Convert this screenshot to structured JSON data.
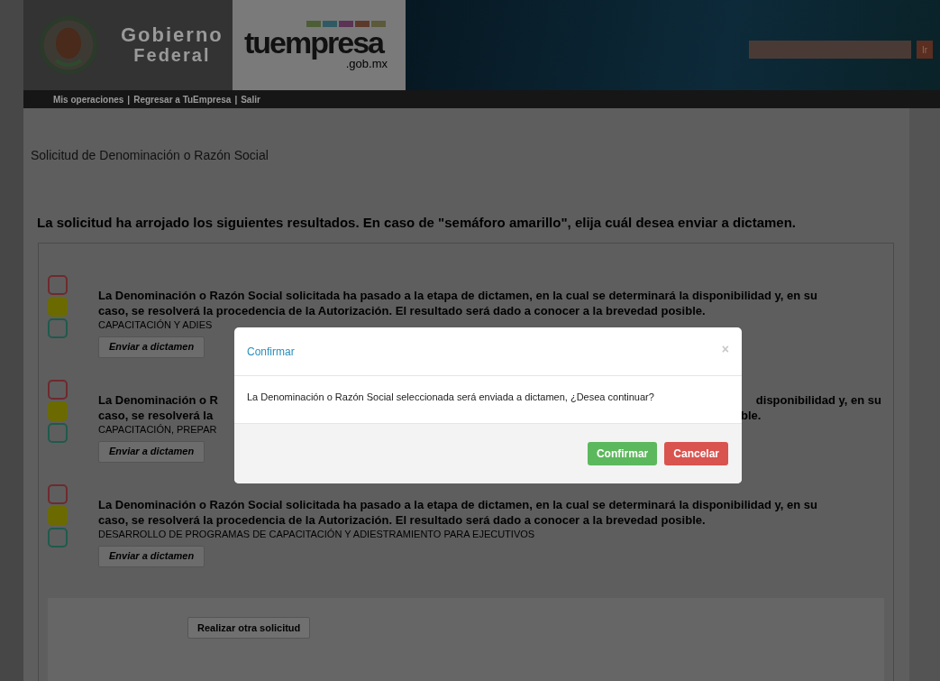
{
  "header": {
    "government_logo": {
      "line_1": "Gobierno",
      "line_2": "Federal"
    },
    "brand_logo": {
      "name": "tuempresa",
      "domain": ".gob.mx"
    },
    "search": {
      "button": "Ir"
    },
    "nav": [
      {
        "label": "Mis operaciones"
      },
      {
        "label": "Regresar a TuEmpresa"
      },
      {
        "label": "Salir"
      }
    ],
    "nav_separator": "|"
  },
  "page_title": "Solicitud de Denominación o Razón Social",
  "instructions": "La solicitud ha arrojado los siguientes resultados. En caso de \"semáforo amarillo\", elija cuál desea enviar a dictamen.",
  "results": [
    {
      "lights": [
        {
          "color": "#6e2a2e",
          "on": false
        },
        {
          "color": "#6a6a00",
          "on": true
        },
        {
          "color": "#1f5a4c",
          "on": false
        }
      ],
      "lines": [
        {
          "left": "La Denominación o Razón Social solicitada ha pasado a la etapa de dictamen, en la cual se determinará la disponibilidad y, en su"
        },
        {
          "left": "caso, se resolverá la procedencia de la Autorización. El resultado será dado a conocer a la brevedad posible."
        }
      ],
      "name": "CAPACITACIÓN Y ADIES",
      "button": "Enviar a dictamen"
    },
    {
      "lights": [
        {
          "color": "#6e2a2e",
          "on": false
        },
        {
          "color": "#6a6a00",
          "on": true
        },
        {
          "color": "#1f5a4c",
          "on": false
        }
      ],
      "lines": [
        {
          "left": "La Denominación o R",
          "right": "disponibilidad y, en su"
        },
        {
          "left": "caso, se resolverá la",
          "right": "ble."
        }
      ],
      "name": "CAPACITACIÓN, PREPAR",
      "button": "Enviar a dictamen"
    },
    {
      "lights": [
        {
          "color": "#6e2a2e",
          "on": false
        },
        {
          "color": "#6a6a00",
          "on": true
        },
        {
          "color": "#1f5a4c",
          "on": false
        }
      ],
      "lines": [
        {
          "left": "La Denominación o Razón Social solicitada ha pasado a la etapa de dictamen, en la cual se determinará la disponibilidad y, en su"
        },
        {
          "left": "caso, se resolverá la procedencia de la Autorización. El resultado será dado a conocer a la brevedad posible."
        }
      ],
      "name": "DESARROLLO DE PROGRAMAS DE CAPACITACIÓN Y ADIESTRAMIENTO PARA EJECUTIVOS",
      "button": "Enviar a dictamen"
    }
  ],
  "footer_button": "Realizar otra solicitud",
  "dialog": {
    "title": "Confirmar",
    "close": "×",
    "message": "La Denominación o Razón Social seleccionada será enviada a dictamen, ¿Desea continuar?",
    "buttons": [
      {
        "label": "Confirmar",
        "kind": "primary"
      },
      {
        "label": "Cancelar",
        "kind": "danger"
      }
    ]
  }
}
